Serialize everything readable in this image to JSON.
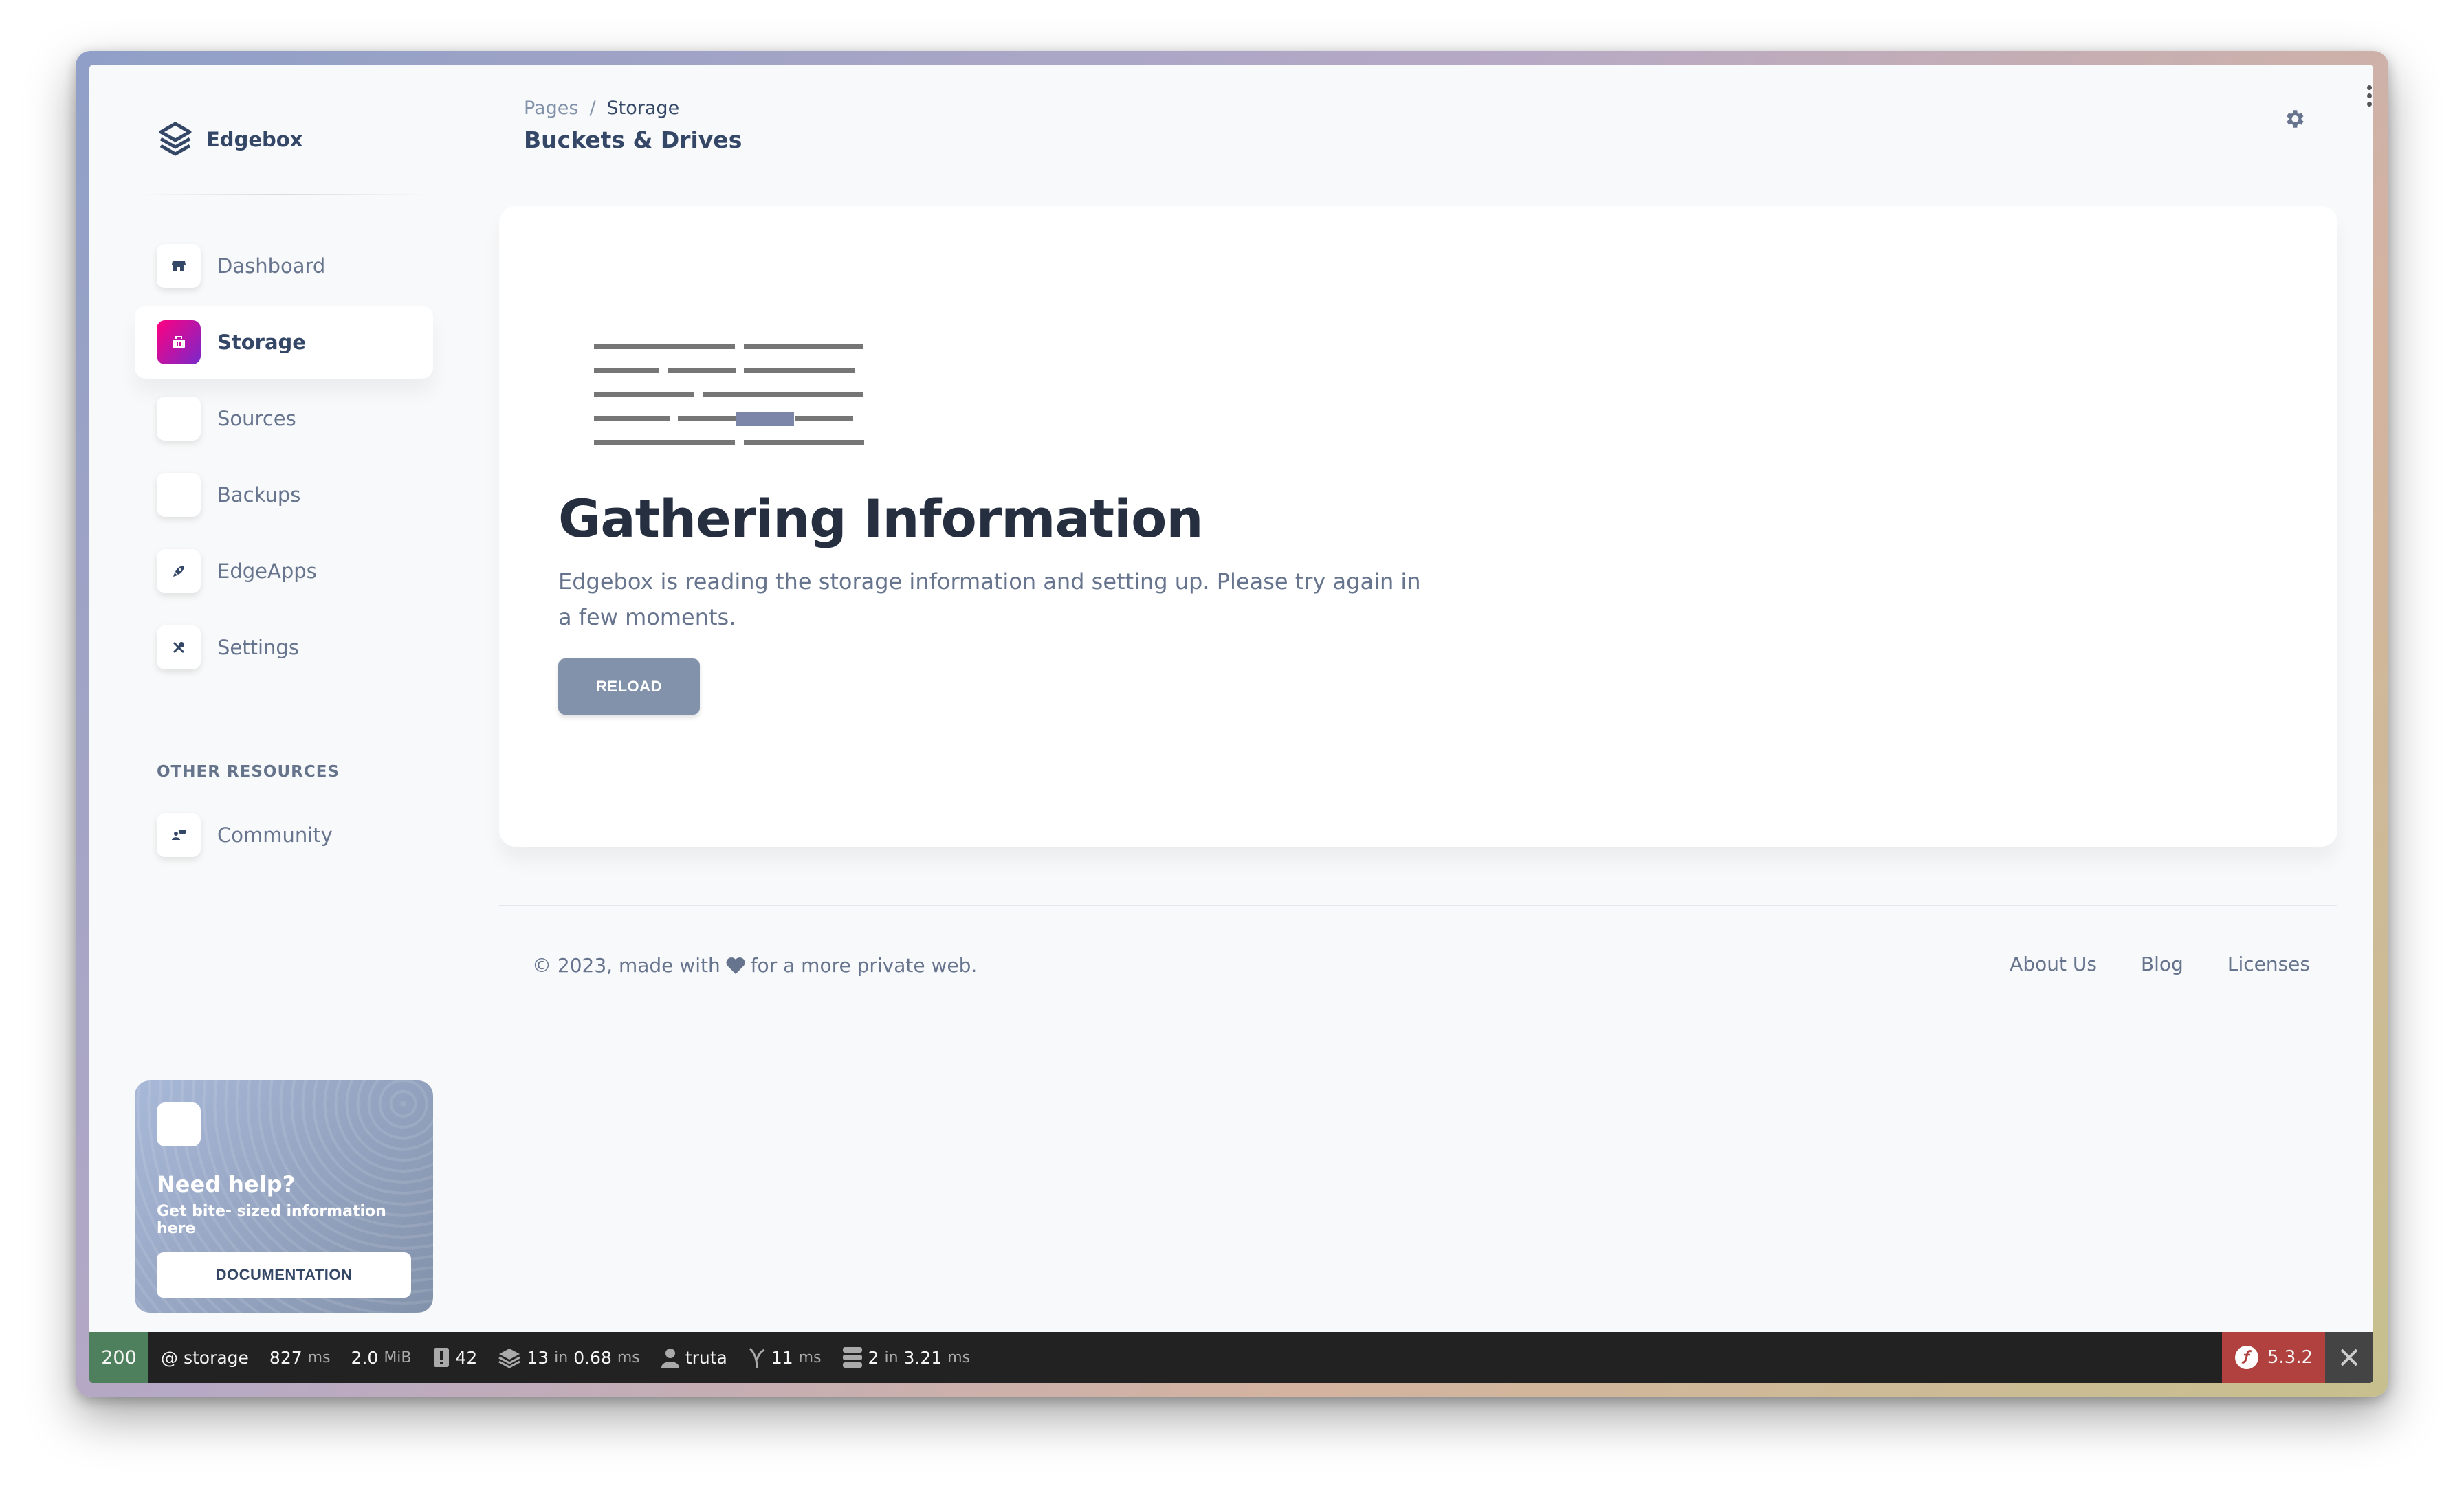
{
  "brand": {
    "name": "Edgebox"
  },
  "sidebar": {
    "items": [
      {
        "label": "Dashboard",
        "icon": "shop-icon",
        "active": false
      },
      {
        "label": "Storage",
        "icon": "storage-icon",
        "active": true
      },
      {
        "label": "Sources",
        "icon": "",
        "active": false
      },
      {
        "label": "Backups",
        "icon": "",
        "active": false
      },
      {
        "label": "EdgeApps",
        "icon": "rocket-icon",
        "active": false
      },
      {
        "label": "Settings",
        "icon": "tools-icon",
        "active": false
      }
    ],
    "section_title": "OTHER RESOURCES",
    "resources": [
      {
        "label": "Community",
        "icon": "community-icon"
      }
    ]
  },
  "help_card": {
    "title": "Need help?",
    "subtitle": "Get bite- sized information here",
    "button": "DOCUMENTATION"
  },
  "header": {
    "breadcrumb_root": "Pages",
    "breadcrumb_separator": "/",
    "breadcrumb_current": "Storage",
    "title": "Buckets & Drives"
  },
  "main": {
    "title": "Gathering Information",
    "text": "Edgebox is reading the storage information and setting up. Please try again in a few moments.",
    "button": "RELOAD"
  },
  "footer": {
    "copyright_before": "© 2023, made with",
    "copyright_after": "for a more private web.",
    "links": [
      "About Us",
      "Blog",
      "Licenses"
    ]
  },
  "toolbar": {
    "status": "200",
    "route": "@ storage",
    "time_value": "827",
    "time_unit": "ms",
    "memory_value": "2.0",
    "memory_unit": "MiB",
    "logs": "42",
    "cache_value": "13",
    "cache_in": "in",
    "cache_time": "0.68",
    "cache_unit": "ms",
    "user": "truta",
    "twig_value": "11",
    "twig_unit": "ms",
    "db_value": "2",
    "db_in": "in",
    "db_time": "3.21",
    "db_unit": "ms",
    "version": "5.3.2"
  },
  "colors": {
    "accent": "#cb0c9f",
    "text_dark": "#344767",
    "text_muted": "#67748e",
    "toolbar_status": "#4f805d",
    "toolbar_version": "#b0413e"
  }
}
